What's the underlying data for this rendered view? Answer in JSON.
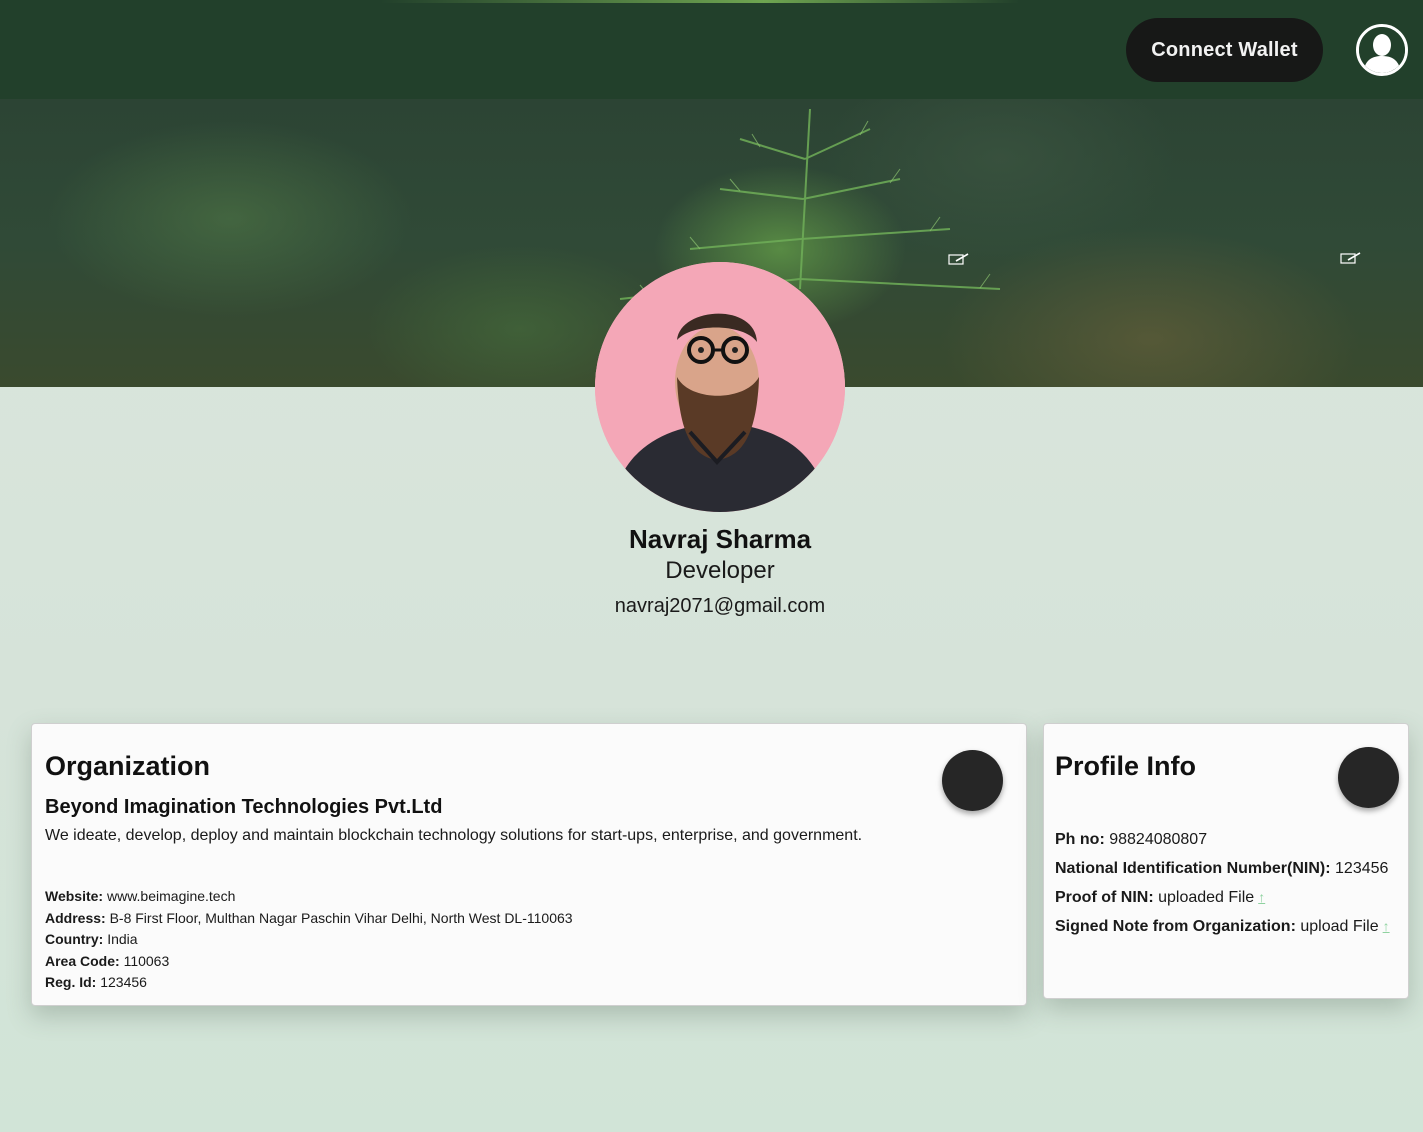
{
  "header": {
    "connect_wallet_label": "Connect Wallet",
    "account_icon": "user-silhouette-icon"
  },
  "banner": {
    "edit_icon": "edit-pencil-icon"
  },
  "profile": {
    "name": "Navraj Sharma",
    "role": "Developer",
    "email": "navraj2071@gmail.com"
  },
  "organization": {
    "title": "Organization",
    "name": "Beyond Imagination Technologies Pvt.Ltd",
    "description": "We ideate, develop, deploy and maintain blockchain technology solutions for start-ups, enterprise, and government.",
    "details": [
      {
        "label": "Website:",
        "value": " www.beimagine.tech"
      },
      {
        "label": "Address:",
        "value": "B-8 First Floor, Multhan Nagar Paschin Vihar Delhi, North West DL-110063"
      },
      {
        "label": "Country:",
        "value": "India"
      },
      {
        "label": "Area Code:",
        "value": "110063"
      },
      {
        "label": "Reg. Id:",
        "value": "123456"
      }
    ]
  },
  "profile_info": {
    "title": "Profile Info",
    "items": [
      {
        "label": "Ph no:",
        "value": "98824080807"
      },
      {
        "label": "National Identification Number(NIN):",
        "value": "123456"
      },
      {
        "label": "Proof of NIN:",
        "value": "uploaded File"
      },
      {
        "label": "Signed Note from Organization:",
        "value": "upload File"
      }
    ],
    "upload_icon": "upload-arrow-icon"
  },
  "colors": {
    "header_bg": "#22402b",
    "button_bg": "#171817",
    "page_bg": "#d6e3d9",
    "upload_accent": "#8fd2a0"
  }
}
